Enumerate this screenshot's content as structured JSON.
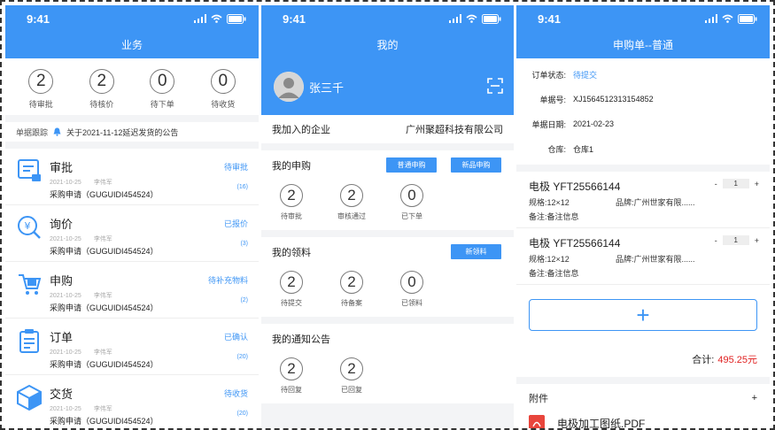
{
  "status_time": "9:41",
  "business": {
    "title": "业务",
    "stats": [
      {
        "value": "2",
        "label": "待审批"
      },
      {
        "value": "2",
        "label": "待核价"
      },
      {
        "value": "0",
        "label": "待下单"
      },
      {
        "value": "0",
        "label": "待收货"
      }
    ],
    "notice_label": "单据跟踪",
    "notice_text": "关于2021-11-12延迟发货的公告",
    "items": [
      {
        "title": "审批",
        "date": "2021-10-25",
        "name": "李伟军",
        "subtitle": "采购申请（GUGUIDI454524）",
        "status": "待审批",
        "count": "(16)",
        "icon": "approval-icon"
      },
      {
        "title": "询价",
        "date": "2021-10-25",
        "name": "李伟军",
        "subtitle": "采购申请（GUGUIDI454524）",
        "status": "已报价",
        "count": "(3)",
        "icon": "price-inquiry-icon"
      },
      {
        "title": "申购",
        "date": "2021-10-25",
        "name": "李伟军",
        "subtitle": "采购申请（GUGUIDI454524）",
        "status": "待补充物料",
        "count": "(2)",
        "icon": "cart-icon"
      },
      {
        "title": "订单",
        "date": "2021-10-25",
        "name": "李伟军",
        "subtitle": "采购申请（GUGUIDI454524）",
        "status": "已确认",
        "count": "(20)",
        "icon": "clipboard-icon"
      },
      {
        "title": "交货",
        "date": "2021-10-25",
        "name": "李伟军",
        "subtitle": "采购申请（GUGUIDI454524）",
        "status": "待收货",
        "count": "(20)",
        "icon": "box-icon"
      }
    ]
  },
  "mine": {
    "title": "我的",
    "user_name": "张三千",
    "company_label": "我加入的企业",
    "company_name": "广州聚超科技有限公司",
    "purchase": {
      "title": "我的申购",
      "btn_normal": "普通申购",
      "btn_new": "新品申购",
      "stats": [
        {
          "value": "2",
          "label": "待审批"
        },
        {
          "value": "2",
          "label": "审核通过"
        },
        {
          "value": "0",
          "label": "已下单"
        }
      ]
    },
    "material": {
      "title": "我的领料",
      "btn_new": "新领料",
      "stats": [
        {
          "value": "2",
          "label": "待提交"
        },
        {
          "value": "2",
          "label": "待备案"
        },
        {
          "value": "0",
          "label": "已领料"
        }
      ]
    },
    "notice": {
      "title": "我的通知公告",
      "stats": [
        {
          "value": "2",
          "label": "待回复"
        },
        {
          "value": "2",
          "label": "已回复"
        }
      ]
    }
  },
  "order": {
    "title": "申购单--普通",
    "fields": [
      {
        "label": "订单状态:",
        "value": "待提交",
        "accent": true
      },
      {
        "label": "单据号:",
        "value": "XJ1564512313154852",
        "accent": false
      },
      {
        "label": "单据日期:",
        "value": "2021-02-23",
        "accent": false
      },
      {
        "label": "仓库:",
        "value": "仓库1",
        "accent": false
      }
    ],
    "products": [
      {
        "name": "电极 YFT25566144",
        "spec_label": "规格:",
        "spec": "12×12",
        "brand_label": "品牌:",
        "brand": "广州世家有限......",
        "note_label": "备注:",
        "note": "备注信息",
        "qty": "1"
      },
      {
        "name": "电极 YFT25566144",
        "spec_label": "规格:",
        "spec": "12×12",
        "brand_label": "品牌:",
        "brand": "广州世家有限......",
        "note_label": "备注:",
        "note": "备注信息",
        "qty": "1"
      }
    ],
    "add_symbol": "+",
    "total_label": "合计:",
    "total_value": "495.25元",
    "attach_label": "附件",
    "attach_add": "+",
    "file_name": "电极加工图纸.PDF"
  },
  "colors": {
    "accent": "#3d95f5",
    "danger": "#e02020"
  }
}
